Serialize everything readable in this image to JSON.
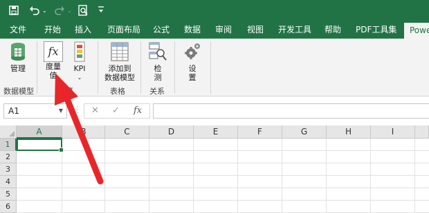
{
  "quick_access": {
    "save_icon": "save-icon",
    "undo_icon": "undo-icon",
    "redo_icon": "redo-icon",
    "print_preview_icon": "print-preview-icon",
    "customize_icon": "customize-qat-icon"
  },
  "tabs": [
    "文件",
    "开始",
    "插入",
    "页面布局",
    "公式",
    "数据",
    "审阅",
    "视图",
    "开发工具",
    "帮助",
    "PDF工具集",
    "Power"
  ],
  "active_tab": "Power",
  "ribbon": {
    "manage": "管理",
    "group_data_model": "数据模型",
    "measures_line1": "度量",
    "measures_line2": "值",
    "kpi": "KPI",
    "group_calculations_partial": "算",
    "add_to_line1": "添加到",
    "add_to_line2": "数据模型",
    "group_tables": "表格",
    "detect_line1": "检",
    "detect_line2": "测",
    "group_relationships": "关系",
    "settings_line1": "设",
    "settings_line2": "置",
    "fx_glyph": "fx"
  },
  "formula_bar": {
    "name_box": "A1",
    "cancel": "✕",
    "enter": "✓",
    "fx": "fx",
    "formula": ""
  },
  "grid": {
    "columns": [
      "A",
      "B",
      "C",
      "D",
      "E",
      "F",
      "G",
      "H",
      "I"
    ],
    "rows": [
      "1",
      "2",
      "3",
      "4",
      "5",
      "6",
      "7"
    ],
    "selected_cell": "A1"
  },
  "colors": {
    "excel_green": "#217346",
    "arrow_red": "#e8262a"
  }
}
